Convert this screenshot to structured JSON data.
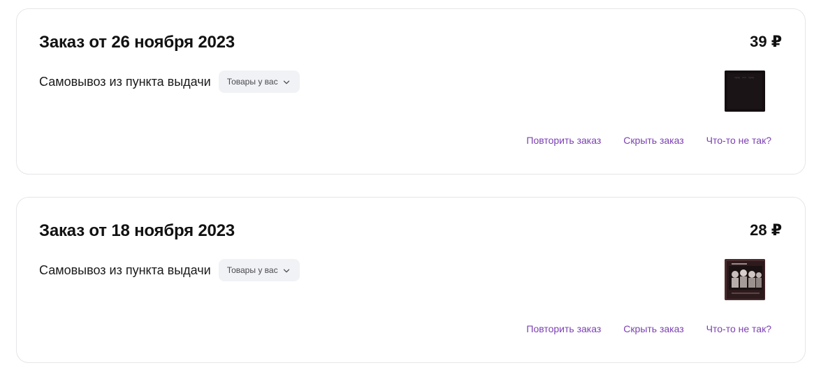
{
  "orders": [
    {
      "title": "Заказ от 26 ноября 2023",
      "price": "39 ₽",
      "delivery": "Самовывоз из пункта выдачи",
      "goods_chip": "Товары у вас",
      "thumbnail_icon": "album-cover-dark",
      "actions": {
        "repeat": "Повторить заказ",
        "hide": "Скрыть заказ",
        "problem": "Что-то не так?"
      }
    },
    {
      "title": "Заказ от 18 ноября 2023",
      "price": "28 ₽",
      "delivery": "Самовывоз из пункта выдачи",
      "goods_chip": "Товары у вас",
      "thumbnail_icon": "album-cover-photo",
      "actions": {
        "repeat": "Повторить заказ",
        "hide": "Скрыть заказ",
        "problem": "Что-то не так?"
      }
    }
  ],
  "colors": {
    "accent_link": "#7b3fb3",
    "chip_bg": "#f1f2f5",
    "card_border": "#e6e6ea"
  }
}
